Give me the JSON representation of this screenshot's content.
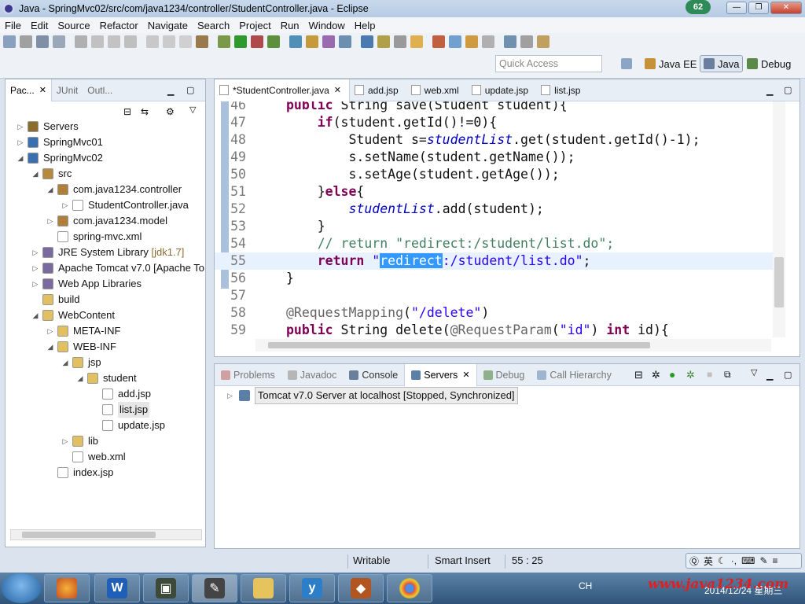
{
  "window": {
    "title": "Java - SpringMvc02/src/com/java1234/controller/StudentController.java - Eclipse",
    "badge": "62",
    "buttons": [
      "—",
      "❐",
      "✕"
    ]
  },
  "menu": [
    "File",
    "Edit",
    "Source",
    "Refactor",
    "Navigate",
    "Search",
    "Project",
    "Run",
    "Window",
    "Help"
  ],
  "quick_access": {
    "placeholder": "Quick Access"
  },
  "perspectives": [
    "Java EE",
    "Java",
    "Debug"
  ],
  "left_panel": {
    "tabs": [
      "Pac...",
      "JUnit",
      "Outl..."
    ],
    "tree": [
      {
        "label": "Servers",
        "decoration": ""
      },
      {
        "label": "SpringMvc01",
        "decoration": ""
      },
      {
        "label": "SpringMvc02",
        "decoration": ""
      },
      {
        "label": "src",
        "decoration": ""
      },
      {
        "label": "com.java1234.controller",
        "decoration": ""
      },
      {
        "label": "StudentController.java",
        "decoration": ""
      },
      {
        "label": "com.java1234.model",
        "decoration": ""
      },
      {
        "label": "spring-mvc.xml",
        "decoration": ""
      },
      {
        "label": "JRE System Library",
        "decoration": "[jdk1.7]"
      },
      {
        "label": "Apache Tomcat v7.0 [Apache To",
        "decoration": ""
      },
      {
        "label": "Web App Libraries",
        "decoration": ""
      },
      {
        "label": "build",
        "decoration": ""
      },
      {
        "label": "WebContent",
        "decoration": ""
      },
      {
        "label": "META-INF",
        "decoration": ""
      },
      {
        "label": "WEB-INF",
        "decoration": ""
      },
      {
        "label": "jsp",
        "decoration": ""
      },
      {
        "label": "student",
        "decoration": ""
      },
      {
        "label": "add.jsp",
        "decoration": ""
      },
      {
        "label": "list.jsp",
        "decoration": ""
      },
      {
        "label": "update.jsp",
        "decoration": ""
      },
      {
        "label": "lib",
        "decoration": ""
      },
      {
        "label": "web.xml",
        "decoration": ""
      },
      {
        "label": "index.jsp",
        "decoration": ""
      }
    ]
  },
  "editor": {
    "tabs": [
      "*StudentController.java",
      "add.jsp",
      "web.xml",
      "update.jsp",
      "list.jsp"
    ],
    "lines": [
      {
        "num": "46",
        "parts": [
          [
            "kw",
            "public"
          ],
          [
            "",
            " "
          ],
          [
            "",
            "String"
          ],
          [
            "",
            " save(Student student){"
          ]
        ]
      },
      {
        "num": "47",
        "parts": [
          [
            "",
            "    "
          ],
          [
            "kw",
            "if"
          ],
          [
            "",
            "(student.getId()!=0){"
          ]
        ]
      },
      {
        "num": "48",
        "parts": [
          [
            "",
            "        Student s="
          ],
          [
            "fld",
            "studentList"
          ],
          [
            "",
            ".get(student.getId()-1);"
          ]
        ]
      },
      {
        "num": "49",
        "parts": [
          [
            "",
            "        s.setName(student.getName());"
          ]
        ]
      },
      {
        "num": "50",
        "parts": [
          [
            "",
            "        s.setAge(student.getAge());"
          ]
        ]
      },
      {
        "num": "51",
        "parts": [
          [
            "",
            "    }"
          ],
          [
            "kw",
            "else"
          ],
          [
            "",
            "{"
          ]
        ]
      },
      {
        "num": "52",
        "parts": [
          [
            "",
            "        "
          ],
          [
            "fld",
            "studentList"
          ],
          [
            "",
            ".add(student);"
          ]
        ]
      },
      {
        "num": "53",
        "parts": [
          [
            "",
            "    }"
          ]
        ]
      },
      {
        "num": "54",
        "parts": [
          [
            "",
            "    "
          ],
          [
            "cm",
            "// return \"redirect:/student/list.do\";"
          ]
        ]
      },
      {
        "num": "55",
        "parts": [
          [
            "",
            "    "
          ],
          [
            "kw",
            "return"
          ],
          [
            "",
            " "
          ],
          [
            "str",
            "\""
          ],
          [
            "selected",
            "redirect"
          ],
          [
            "str",
            ":/student/list.do\""
          ],
          [
            "",
            ";"
          ]
        ]
      },
      {
        "num": "56",
        "parts": [
          [
            "",
            "}"
          ]
        ]
      },
      {
        "num": "57",
        "parts": [
          [
            "",
            ""
          ]
        ]
      },
      {
        "num": "58",
        "parts": [
          [
            "ann",
            "@RequestMapping"
          ],
          [
            "",
            "("
          ],
          [
            "str",
            "\"/delete\""
          ],
          [
            "",
            ")"
          ]
        ]
      },
      {
        "num": "59",
        "parts": [
          [
            "kw",
            "public"
          ],
          [
            "",
            " String delete("
          ],
          [
            "ann",
            "@RequestParam"
          ],
          [
            "",
            "("
          ],
          [
            "str",
            "\"id\""
          ],
          [
            "",
            ") "
          ],
          [
            "kw",
            "int"
          ],
          [
            "",
            " id){"
          ]
        ]
      }
    ]
  },
  "bottom_panel": {
    "tabs": [
      "Problems",
      "Javadoc",
      "Console",
      "Servers",
      "Debug",
      "Call Hierarchy"
    ],
    "server": "Tomcat v7.0 Server at localhost  [Stopped, Synchronized]"
  },
  "status": {
    "writable": "Writable",
    "insert_mode": "Smart Insert",
    "position": "55 : 25"
  },
  "ime": {
    "lang": "英"
  },
  "taskbar": {
    "tray": "CH",
    "clock": "2014/12/24 星期三",
    "watermark": "www.java1234.com"
  }
}
